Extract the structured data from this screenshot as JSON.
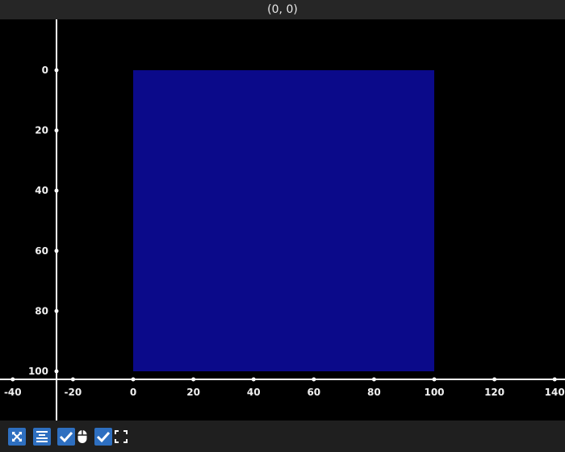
{
  "window": {
    "title": "(0, 0)"
  },
  "plot": {
    "background": "#000000",
    "axis_color": "#ffffff",
    "x_ticks": [
      "-40",
      "-20",
      "0",
      "20",
      "40",
      "60",
      "80",
      "100",
      "120",
      "140"
    ],
    "y_ticks": [
      "0",
      "20",
      "40",
      "60",
      "80",
      "100"
    ],
    "rect": {
      "x0": 0,
      "y0": 0,
      "x1": 100,
      "y1": 100,
      "color": "#0b0a8a"
    }
  },
  "toolbar": {
    "accent": "#2e6fc0",
    "buttons": [
      {
        "icon": "fit-view-icon",
        "checked": false
      },
      {
        "icon": "align-center-icon",
        "checked": false
      },
      {
        "icon": "checkmark-icon",
        "checked": true
      },
      {
        "icon": "mouse-icon",
        "checked": false
      },
      {
        "icon": "checkmark-icon",
        "checked": true
      },
      {
        "icon": "fullscreen-icon",
        "checked": false
      }
    ]
  }
}
